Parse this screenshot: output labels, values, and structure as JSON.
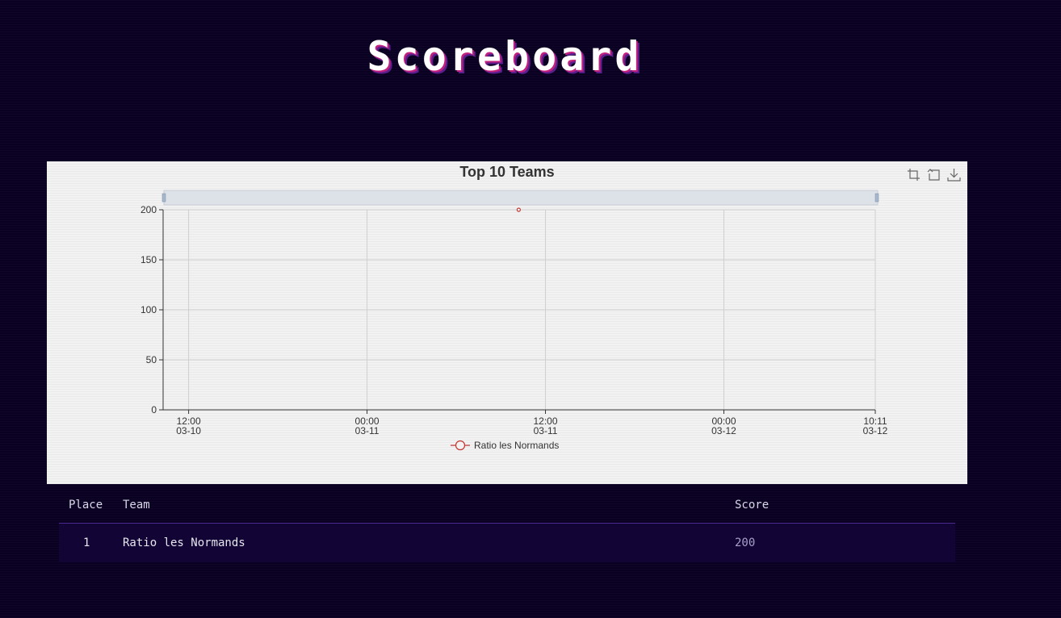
{
  "page": {
    "title": "Scoreboard"
  },
  "chart_data": {
    "type": "line",
    "title": "Top 10 Teams",
    "xlabel": "",
    "ylabel": "",
    "ylim": [
      0,
      200
    ],
    "y_ticks": [
      0,
      50,
      100,
      150,
      200
    ],
    "x_ticks": [
      {
        "time": "12:00",
        "date": "03-10"
      },
      {
        "time": "00:00",
        "date": "03-11"
      },
      {
        "time": "12:00",
        "date": "03-11"
      },
      {
        "time": "00:00",
        "date": "03-12"
      },
      {
        "time": "10:11",
        "date": "03-12"
      }
    ],
    "x_range": [
      "2024-03-10T10:17",
      "2024-03-12T10:11"
    ],
    "grid": true,
    "legend_position": "bottom",
    "series": [
      {
        "name": "Ratio les Normands",
        "color": "#c23531",
        "points": [
          {
            "x": "2024-03-11T10:12",
            "y": 200
          }
        ]
      }
    ],
    "toolbox": [
      "zoom-icon",
      "zoom-reset-icon",
      "download-icon"
    ]
  },
  "table": {
    "headers": {
      "place": "Place",
      "team": "Team",
      "score": "Score"
    },
    "rows": [
      {
        "place": "1",
        "team": "Ratio les Normands",
        "score": "200"
      }
    ]
  },
  "colors": {
    "background": "#0a0022",
    "title_shadow_pink": "#c2207f",
    "title_shadow_purple": "#5a1e8e",
    "chart_background": "#f2f2f2",
    "row_background": "#120535",
    "header_border": "#4a2a90"
  }
}
